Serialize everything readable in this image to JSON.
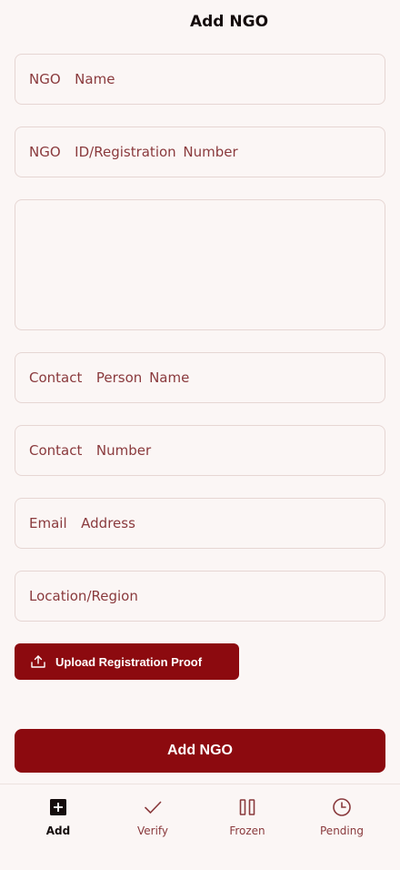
{
  "header": {
    "title": "Add NGO"
  },
  "form": {
    "ngo_name_placeholder": "NGO  Name",
    "ngo_id_placeholder": "NGO  ID/Registration Number",
    "description_placeholder": "",
    "contact_person_placeholder": "Contact  Person Name",
    "contact_number_placeholder": "Contact  Number",
    "email_placeholder": "Email  Address",
    "location_placeholder": "Location/Region",
    "upload_label": "Upload Registration Proof",
    "submit_label": "Add NGO"
  },
  "nav": {
    "items": [
      {
        "label": "Add",
        "icon": "add-square-icon",
        "active": true
      },
      {
        "label": "Verify",
        "icon": "check-icon",
        "active": false
      },
      {
        "label": "Frozen",
        "icon": "pause-icon",
        "active": false
      },
      {
        "label": "Pending",
        "icon": "clock-icon",
        "active": false
      }
    ]
  },
  "colors": {
    "accent": "#8c0a0f",
    "placeholder": "#8a3a3d",
    "background": "#fbf6f5",
    "border": "#e6d6d3"
  }
}
